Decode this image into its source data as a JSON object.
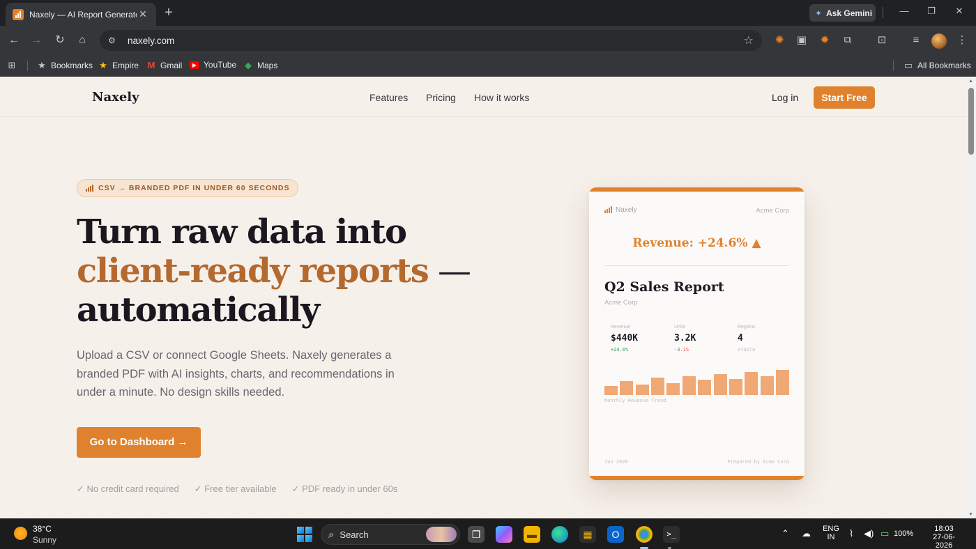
{
  "browser": {
    "tab_title": "Naxely — AI Report Generator",
    "ask_gemini": "Ask Gemini",
    "url": "naxely.com",
    "bookmarks": [
      "Bookmarks",
      "Empire",
      "Gmail",
      "YouTube",
      "Maps"
    ],
    "all_bookmarks": "All Bookmarks"
  },
  "site": {
    "logo": "Naxely",
    "nav": [
      "Features",
      "Pricing",
      "How it works"
    ],
    "login": "Log in",
    "start_free": "Start Free"
  },
  "hero": {
    "badge": "CSV → BRANDED PDF IN UNDER 60 SECONDS",
    "headline_line1": "Turn raw data into",
    "headline_accent": "client-ready reports",
    "headline_dash": " —",
    "headline_line3": "automatically",
    "subcopy": "Upload a CSV or connect Google Sheets. Naxely generates a branded PDF with AI insights, charts, and recommendations in under a minute. No design skills needed.",
    "cta": "Go to Dashboard →",
    "checks": [
      "✓ No credit card required",
      "✓ Free tier available",
      "✓ PDF ready in under 60s"
    ]
  },
  "report_card": {
    "brand": "Naxely",
    "client": "Acme Corp",
    "headline": "Revenue: +24.6% ▲",
    "title": "Q2 Sales Report",
    "subtitle": "Acme Corp",
    "metrics": [
      {
        "label": "Revenue",
        "value": "$440K",
        "delta": "+24.6%",
        "delta_color": "#2f9a55"
      },
      {
        "label": "Units",
        "value": "3.2K",
        "delta": "-3.1%",
        "delta_color": "#d9534f"
      },
      {
        "label": "Regions",
        "value": "4",
        "delta": "stable",
        "delta_color": "#c3bec0"
      }
    ],
    "chart_label": "Monthly Revenue Trend",
    "chart_values": [
      0.36,
      0.55,
      0.42,
      0.7,
      0.47,
      0.76,
      0.62,
      0.82,
      0.65,
      0.93,
      0.75,
      1.0
    ],
    "date": "Jun 2026",
    "prepared": "Prepared by Acme Corp"
  },
  "taskbar": {
    "temp": "38°C",
    "weather": "Sunny",
    "search": "Search",
    "lang_top": "ENG",
    "lang_bottom": "IN",
    "battery": "100%",
    "time": "18:03",
    "date": "27-06-2026"
  },
  "colors": {
    "accent": "#e0822d",
    "headline_accent": "#b4692f",
    "page_bg": "#f6f0ea"
  }
}
